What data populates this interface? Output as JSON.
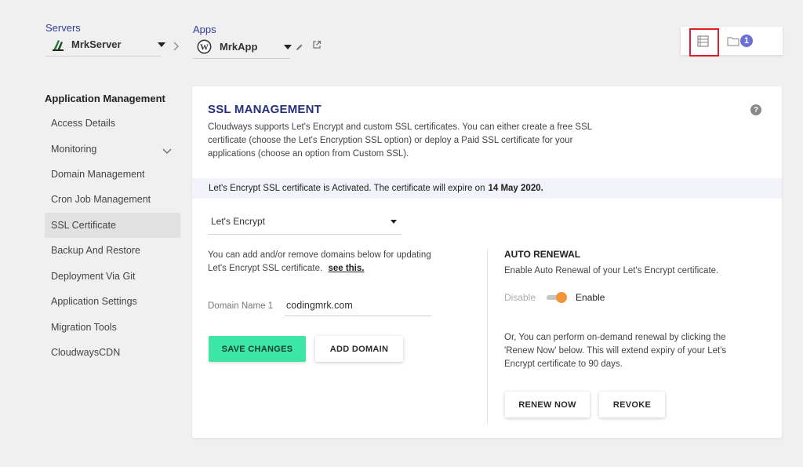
{
  "servers": {
    "label": "Servers",
    "name": "MrkServer"
  },
  "apps": {
    "label": "Apps",
    "name": "MrkApp"
  },
  "notifications": {
    "count": "1"
  },
  "sidebar": {
    "title": "Application Management",
    "items": [
      {
        "label": "Access Details"
      },
      {
        "label": "Monitoring"
      },
      {
        "label": "Domain Management"
      },
      {
        "label": "Cron Job Management"
      },
      {
        "label": "SSL Certificate",
        "active": true
      },
      {
        "label": "Backup And Restore"
      },
      {
        "label": "Deployment Via Git"
      },
      {
        "label": "Application Settings"
      },
      {
        "label": "Migration Tools"
      },
      {
        "label": "CloudwaysCDN"
      }
    ]
  },
  "ssl": {
    "title": "SSL MANAGEMENT",
    "help": "?",
    "description": "Cloudways supports Let's Encrypt and custom SSL certificates. You can either create a free SSL certificate (choose the Let's Encryption SSL option) or deploy a Paid SSL certificate for your applications (choose an option from Custom SSL).",
    "notice_text": "Let's Encrypt SSL certificate is Activated. The certificate will expire on",
    "notice_date": "14 May 2020.",
    "select_value": "Let's Encrypt",
    "domains_text": "You can add and/or remove domains below for updating Let's Encrypt SSL certificate.",
    "see_link": "see this.",
    "domain_label": "Domain Name 1",
    "domain_value": "codingmrk.com",
    "save_button": "SAVE CHANGES",
    "add_button": "ADD DOMAIN",
    "auto_renewal": {
      "title": "AUTO RENEWAL",
      "description": "Enable Auto Renewal of your Let's Encrypt certificate.",
      "disable_label": "Disable",
      "enable_label": "Enable",
      "enabled": true,
      "ondemand_text": "Or, You can perform on-demand renewal by clicking the 'Renew Now' below. This will extend expiry of your Let's Encrypt certificate to 90 days.",
      "renew_button": "RENEW NOW",
      "revoke_button": "REVOKE"
    }
  },
  "colors": {
    "accent": "#2f3d9c",
    "save_green": "#3ee6a6",
    "toggle_orange": "#f4943a",
    "highlight_red": "#e21d2b",
    "badge": "#6b6fd6"
  }
}
